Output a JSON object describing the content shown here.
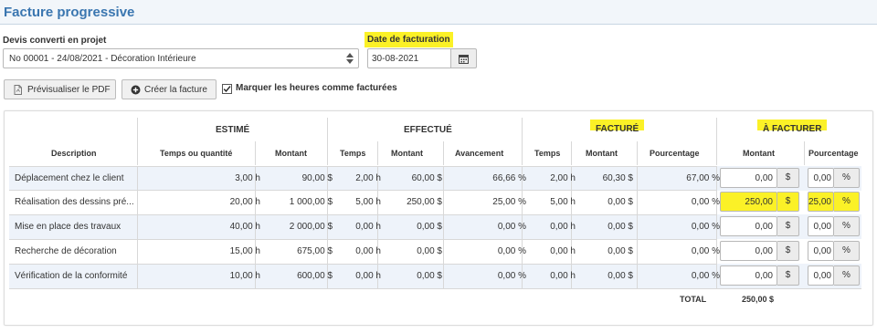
{
  "header": {
    "title": "Facture progressive"
  },
  "form": {
    "devis_label": "Devis converti en projet",
    "devis_value": "No 00001 - 24/08/2021 - Décoration Intérieure",
    "date_label": "Date de facturation",
    "date_value": "30-08-2021"
  },
  "actions": {
    "preview_pdf": "Prévisualiser le PDF",
    "create_invoice": "Créer la facture",
    "mark_hours": "Marquer les heures comme facturées",
    "mark_hours_checked": true
  },
  "table": {
    "groups": {
      "estime": "ESTIMÉ",
      "effectue": "EFFECTUÉ",
      "facture": "FACTURÉ",
      "a_facturer": "À FACTURER"
    },
    "columns": {
      "description": "Description",
      "est_qty": "Temps ou quantité",
      "est_amount": "Montant",
      "eff_time": "Temps",
      "eff_amount": "Montant",
      "eff_progress": "Avancement",
      "fac_time": "Temps",
      "fac_amount": "Montant",
      "fac_percent": "Pourcentage",
      "af_amount": "Montant",
      "af_percent": "Pourcentage"
    },
    "currency_addon": "$",
    "percent_addon": "%",
    "rows": [
      {
        "description": "Déplacement chez le client",
        "est_qty": "3,00 h",
        "est_amount": "90,00 $",
        "eff_time": "2,00 h",
        "eff_amount": "60,00 $",
        "eff_progress": "66,66 %",
        "fac_time": "2,00 h",
        "fac_amount": "60,30 $",
        "fac_percent": "67,00 %",
        "af_amount": "0,00",
        "af_percent": "0,00",
        "highlight": false
      },
      {
        "description": "Réalisation des dessins pré...",
        "est_qty": "20,00 h",
        "est_amount": "1 000,00 $",
        "eff_time": "5,00 h",
        "eff_amount": "250,00 $",
        "eff_progress": "25,00 %",
        "fac_time": "5,00 h",
        "fac_amount": "0,00 $",
        "fac_percent": "0,00 %",
        "af_amount": "250,00",
        "af_percent": "25,00",
        "highlight": true
      },
      {
        "description": "Mise en place des travaux",
        "est_qty": "40,00 h",
        "est_amount": "2 000,00 $",
        "eff_time": "0,00 h",
        "eff_amount": "0,00 $",
        "eff_progress": "0,00 %",
        "fac_time": "0,00 h",
        "fac_amount": "0,00 $",
        "fac_percent": "0,00 %",
        "af_amount": "0,00",
        "af_percent": "0,00",
        "highlight": false
      },
      {
        "description": "Recherche de décoration",
        "est_qty": "15,00 h",
        "est_amount": "675,00 $",
        "eff_time": "0,00 h",
        "eff_amount": "0,00 $",
        "eff_progress": "0,00 %",
        "fac_time": "0,00 h",
        "fac_amount": "0,00 $",
        "fac_percent": "0,00 %",
        "af_amount": "0,00",
        "af_percent": "0,00",
        "highlight": false
      },
      {
        "description": "Vérification de la conformité",
        "est_qty": "10,00 h",
        "est_amount": "600,00 $",
        "eff_time": "0,00 h",
        "eff_amount": "0,00 $",
        "eff_progress": "0,00 %",
        "fac_time": "0,00 h",
        "fac_amount": "0,00 $",
        "fac_percent": "0,00 %",
        "af_amount": "0,00",
        "af_percent": "0,00",
        "highlight": false
      }
    ],
    "total_label": "TOTAL",
    "total_value": "250,00 $"
  },
  "colors": {
    "title": "#3a76b0",
    "highlight": "#fbf127",
    "row_alt": "#eef3fa"
  }
}
